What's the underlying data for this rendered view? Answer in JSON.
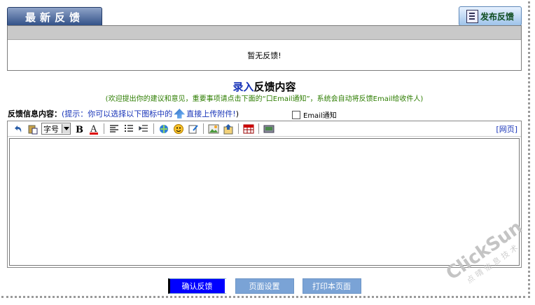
{
  "header": {
    "latest_tab": "最新反馈",
    "publish_button": "发布反馈"
  },
  "feedback_list": {
    "empty_text": "暂无反馈!"
  },
  "form": {
    "title_part1": "录入",
    "title_part2": "反馈内容",
    "tip": "(欢迎提出你的建议和意见，重要事项请点击下面的“口Email通知”，系统会自动将反馈Email给收件人)",
    "content_label": "反馈信息内容：",
    "hint_prefix": "(提示：你可以选择以下图标中的",
    "hint_suffix": "直接上传附件!",
    "hint_close": " )",
    "email_label": "Email通知",
    "email_checked": false
  },
  "editor": {
    "font_size_value": "字号",
    "html_link": "[网页]"
  },
  "actions": {
    "confirm": "确认反馈",
    "page_setup": "页面设置",
    "print": "打印本页面"
  },
  "watermark": {
    "brand": "ClickSun",
    "subtitle": "点晴信息技术"
  },
  "colors": {
    "accent_blue": "#1733b8",
    "tip_green": "#2d7d00",
    "button_blue": "#7aa3d6"
  }
}
